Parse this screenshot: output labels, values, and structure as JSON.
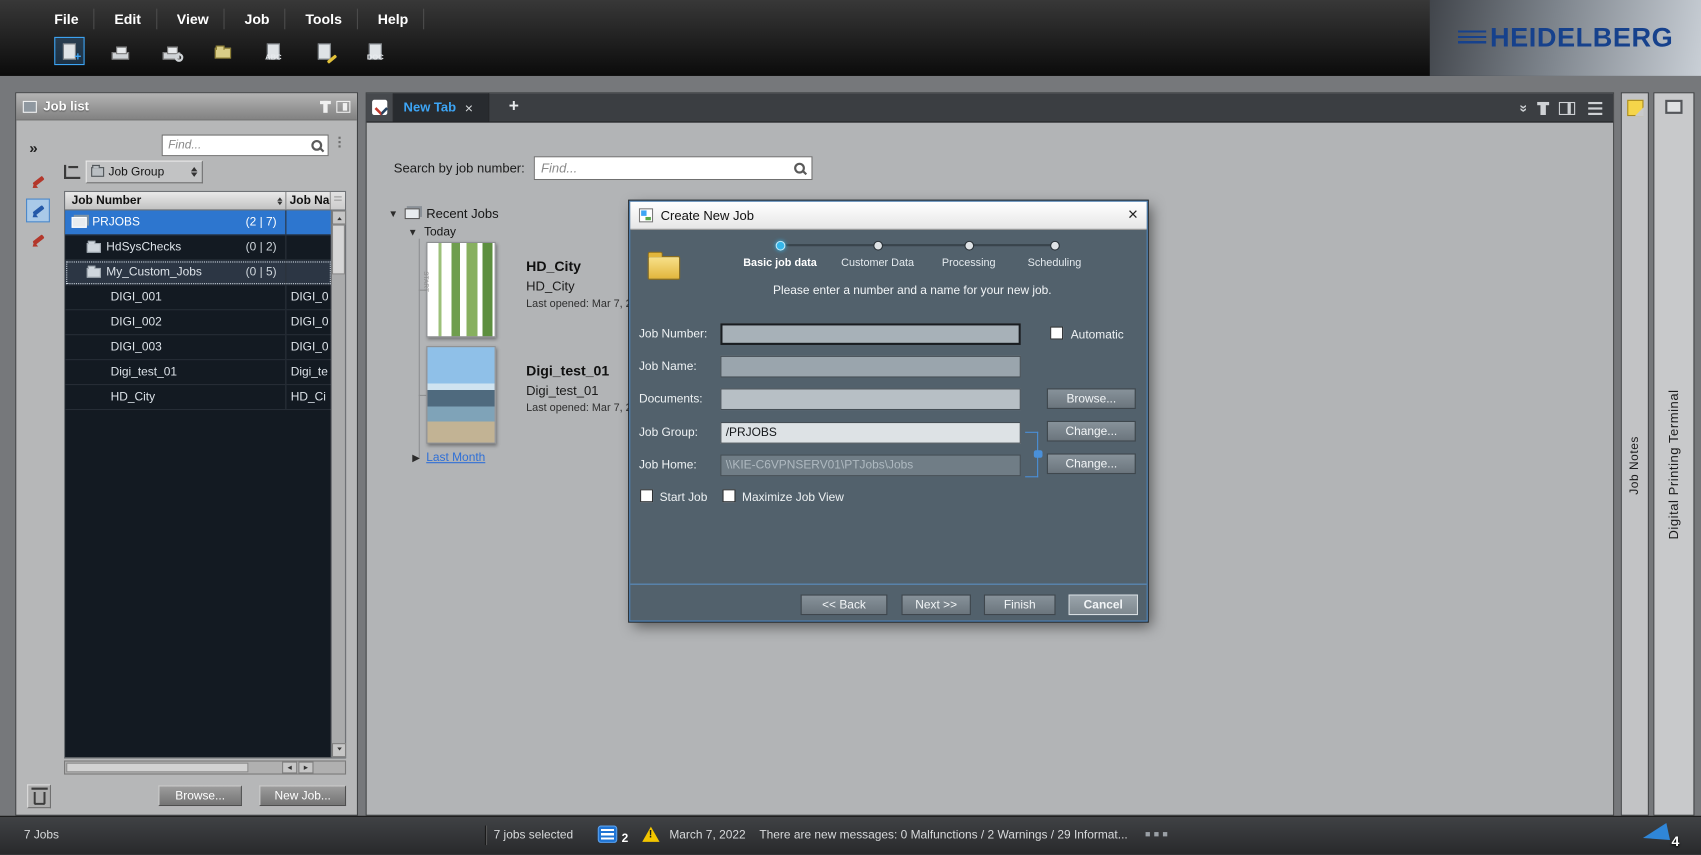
{
  "window": {
    "menus": [
      "File",
      "Edit",
      "View",
      "Job",
      "Tools",
      "Help"
    ],
    "brand": "HEIDELBERG"
  },
  "toolbar": {
    "abc_label": "ABC",
    "doc_label": "DOC"
  },
  "job_list": {
    "title": "Job list",
    "find_placeholder": "Find...",
    "group_button": "Job Group",
    "columns": {
      "job_number": "Job Number",
      "job_name": "Job Name"
    },
    "rows": [
      {
        "name": "PRJOBS",
        "count": "(2 | 7)",
        "name2": ""
      },
      {
        "name": "HdSysChecks",
        "count": "(0 | 2)",
        "name2": ""
      },
      {
        "name": "My_Custom_Jobs",
        "count": "(0 | 5)",
        "name2": ""
      },
      {
        "name": "DIGI_001",
        "count": "",
        "name2": "DIGI_0"
      },
      {
        "name": "DIGI_002",
        "count": "",
        "name2": "DIGI_0"
      },
      {
        "name": "DIGI_003",
        "count": "",
        "name2": "DIGI_0"
      },
      {
        "name": "Digi_test_01",
        "count": "",
        "name2": "Digi_te"
      },
      {
        "name": "HD_City",
        "count": "",
        "name2": "HD_Ci"
      }
    ],
    "browse_button": "Browse...",
    "new_job_button": "New Job..."
  },
  "main": {
    "tab_label": "New Tab",
    "add_tab_label": "+",
    "close_tab_label": "×",
    "search_label": "Search by job number:",
    "find_placeholder": "Find...",
    "recent": {
      "root_label": "Recent Jobs",
      "today_label": "Today",
      "last_month_label": "Last Month",
      "items": [
        {
          "title": "HD_City",
          "name": "HD_City",
          "last_opened": "Last opened: Mar 7, 2",
          "thumb_text": "START"
        },
        {
          "title": "Digi_test_01",
          "name": "Digi_test_01",
          "last_opened": "Last opened: Mar 7, 2"
        }
      ]
    }
  },
  "dialog": {
    "title": "Create New Job",
    "close_label": "×",
    "steps": [
      {
        "label": "Basic job data",
        "active": true
      },
      {
        "label": "Customer Data",
        "active": false
      },
      {
        "label": "Processing",
        "active": false
      },
      {
        "label": "Scheduling",
        "active": false
      }
    ],
    "instruction": "Please enter a number and a name for your new job.",
    "labels": {
      "job_number": "Job Number:",
      "automatic": "Automatic",
      "job_name": "Job Name:",
      "documents": "Documents:",
      "job_group": "Job Group:",
      "job_home": "Job Home:",
      "start_job": "Start Job",
      "maximize": "Maximize Job View"
    },
    "values": {
      "job_group": "/PRJOBS",
      "job_home": "\\\\KIE-C6VPNSERV01\\PTJobs\\Jobs"
    },
    "buttons": {
      "browse": "Browse...",
      "change_group": "Change...",
      "change_home": "Change...",
      "back": "<< Back",
      "next": "Next >>",
      "finish": "Finish",
      "cancel": "Cancel"
    }
  },
  "side_tabs": {
    "job_notes": "Job Notes",
    "terminal": "Digital Printing Terminal"
  },
  "status": {
    "jobs_total": "7 Jobs",
    "jobs_selected": "7 jobs selected",
    "messages_count": "2",
    "date": "March 7, 2022",
    "message": "There are new messages: 0 Malfunctions / 2 Warnings / 29 Informat...",
    "notifications_count": "4"
  },
  "colors": {
    "selection_blue": "#2d76cf",
    "tab_accent_blue": "#3da5f5",
    "brand_blue": "#16418c",
    "warning_yellow": "#f2c500",
    "dialog_slate": "#52616c"
  }
}
